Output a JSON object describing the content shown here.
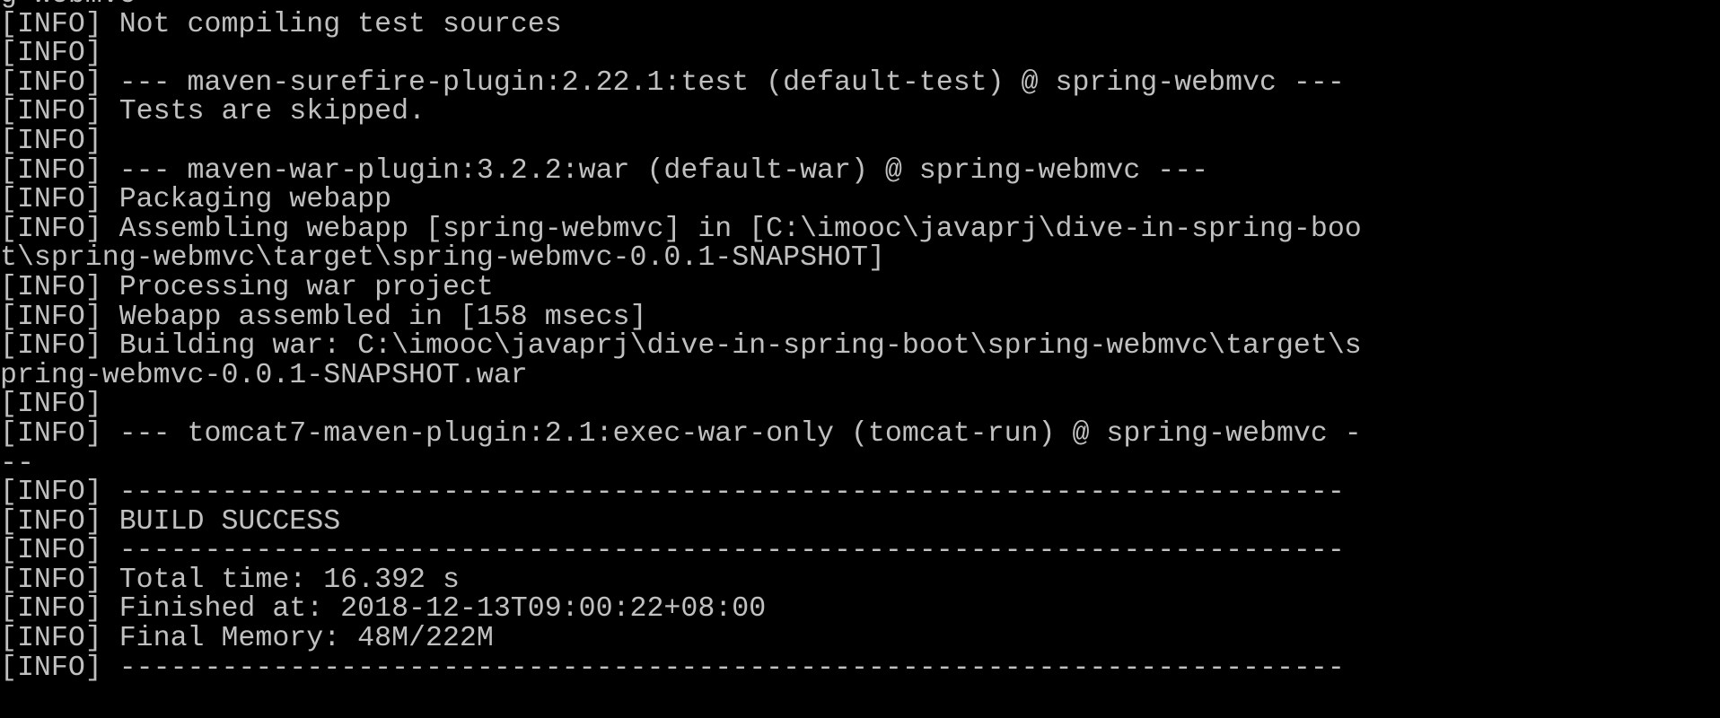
{
  "console": {
    "text_color": "#c0c0c0",
    "background": "#000000",
    "lines": [
      "g webmvc",
      "[INFO] Not compiling test sources",
      "[INFO]",
      "[INFO] --- maven-surefire-plugin:2.22.1:test (default-test) @ spring-webmvc ---",
      "[INFO] Tests are skipped.",
      "[INFO]",
      "[INFO] --- maven-war-plugin:3.2.2:war (default-war) @ spring-webmvc ---",
      "[INFO] Packaging webapp",
      "[INFO] Assembling webapp [spring-webmvc] in [C:\\imooc\\javaprj\\dive-in-spring-boo",
      "t\\spring-webmvc\\target\\spring-webmvc-0.0.1-SNAPSHOT]",
      "[INFO] Processing war project",
      "[INFO] Webapp assembled in [158 msecs]",
      "[INFO] Building war: C:\\imooc\\javaprj\\dive-in-spring-boot\\spring-webmvc\\target\\s",
      "pring-webmvc-0.0.1-SNAPSHOT.war",
      "[INFO]",
      "[INFO] --- tomcat7-maven-plugin:2.1:exec-war-only (tomcat-run) @ spring-webmvc -",
      "--",
      "[INFO] ------------------------------------------------------------------------",
      "[INFO] BUILD SUCCESS",
      "[INFO] ------------------------------------------------------------------------",
      "[INFO] Total time: 16.392 s",
      "[INFO] Finished at: 2018-12-13T09:00:22+08:00",
      "[INFO] Final Memory: 48M/222M",
      "[INFO] ------------------------------------------------------------------------"
    ]
  }
}
